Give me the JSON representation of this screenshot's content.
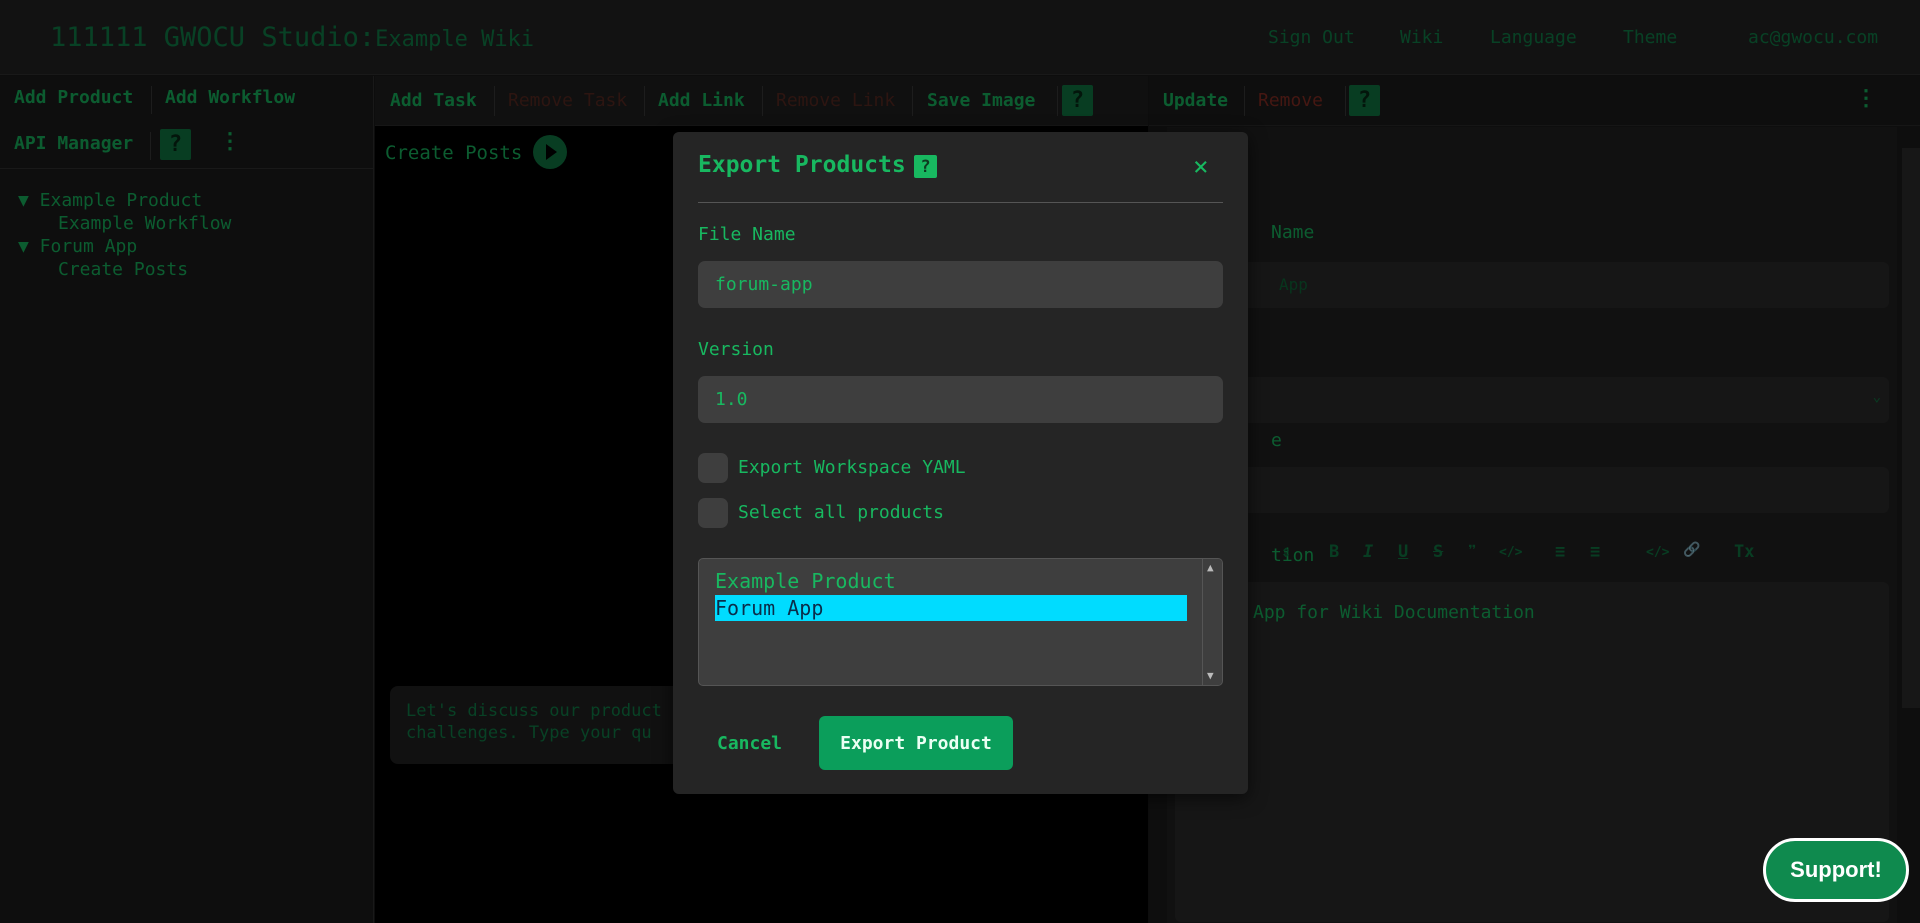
{
  "header": {
    "brand": "111111 GWOCU Studio:",
    "workspace": "Example Wiki",
    "nav": [
      "Sign Out",
      "Wiki",
      "Language",
      "Theme",
      "ac@gwocu.com"
    ]
  },
  "left_panel": {
    "buttons": [
      "Add Product",
      "Add Workflow",
      "API Manager"
    ],
    "help_label": "?",
    "more_label": "⋮",
    "tree": [
      {
        "label": "▼ Example Product",
        "children": [
          "Example Workflow"
        ]
      },
      {
        "label": "▼ Forum App",
        "children": [
          "Create Posts"
        ]
      }
    ]
  },
  "center_panel": {
    "toolbar": [
      "Add Task",
      "Remove Task",
      "Add Link",
      "Remove Link",
      "Save Image"
    ],
    "help_label": "?",
    "workflow_title": "Create Posts",
    "chat_line1": "Let's discuss our product",
    "chat_line2": "challenges. Type your qu"
  },
  "right_panel": {
    "toolbar": [
      "Update",
      "Remove"
    ],
    "help_label": "?",
    "more_label": "⋮",
    "labels": [
      "Name",
      "e",
      "tion"
    ],
    "name_value": "App",
    "description_text": "App for Wiki Documentation",
    "editor_tools": [
      "B",
      "I",
      "U",
      "S",
      "❞",
      "</>",
      "≡",
      "≡",
      "</>",
      "🔗",
      "Tx"
    ]
  },
  "modal": {
    "title": "Export Products",
    "help_label": "?",
    "close_label": "×",
    "file_name_label": "File Name",
    "file_name_value": "forum-app",
    "version_label": "Version",
    "version_value": "1.0",
    "checkbox_yaml": "Export Workspace YAML",
    "checkbox_all": "Select all products",
    "products": [
      "Example Product",
      "Forum App"
    ],
    "selected_product": "Forum App",
    "cancel_label": "Cancel",
    "export_label": "Export Product"
  },
  "support_label": "Support!",
  "colors": {
    "accent": "#18b860",
    "dark_accent": "#117a45",
    "selection": "#00dcff",
    "export_button": "#0b9e5b"
  }
}
